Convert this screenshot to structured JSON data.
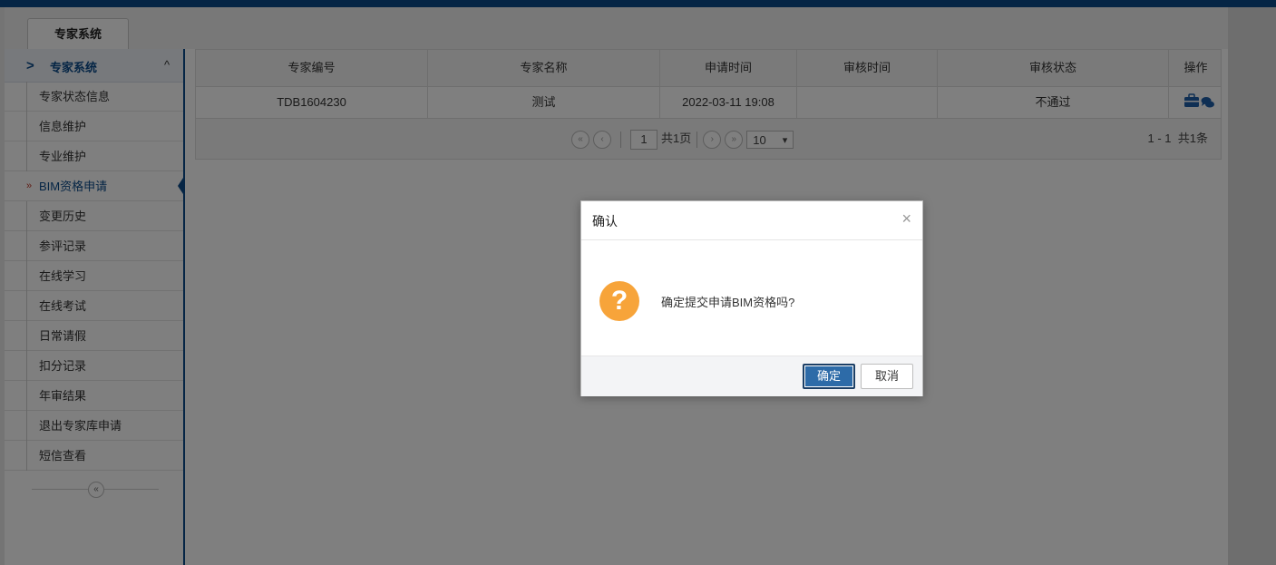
{
  "tab": {
    "label": "专家系统"
  },
  "sidebar": {
    "header": "专家系统",
    "items": [
      {
        "label": "专家状态信息"
      },
      {
        "label": "信息维护"
      },
      {
        "label": "专业维护"
      },
      {
        "label": "BIM资格申请",
        "marker": "»"
      },
      {
        "label": "变更历史"
      },
      {
        "label": "参评记录"
      },
      {
        "label": "在线学习"
      },
      {
        "label": "在线考试"
      },
      {
        "label": "日常请假"
      },
      {
        "label": "扣分记录"
      },
      {
        "label": "年审结果"
      },
      {
        "label": "退出专家库申请"
      },
      {
        "label": "短信查看"
      }
    ],
    "collapse_glyph": "«"
  },
  "grid": {
    "columns": [
      "专家编号",
      "专家名称",
      "申请时间",
      "审核时间",
      "审核状态",
      "操作"
    ],
    "rows": [
      {
        "expert_no": "TDB1604230",
        "expert_name": "测试",
        "apply_time": "2022-03-11 19:08",
        "review_time": "",
        "status": "不通过"
      }
    ],
    "pager": {
      "first": "«",
      "prev": "‹",
      "page": "1",
      "total_pages": "共1页",
      "next": "›",
      "last": "»",
      "page_size": "10",
      "range": "1 - 1",
      "total_records": "共1条"
    }
  },
  "dialog": {
    "title": "确认",
    "close": "×",
    "icon": "?",
    "message": "确定提交申请BIM资格吗?",
    "ok": "确定",
    "cancel": "取消"
  },
  "colors": {
    "accent": "#0b4a8a",
    "warning": "#f7a43a",
    "primary_button": "#2d6ba8"
  }
}
